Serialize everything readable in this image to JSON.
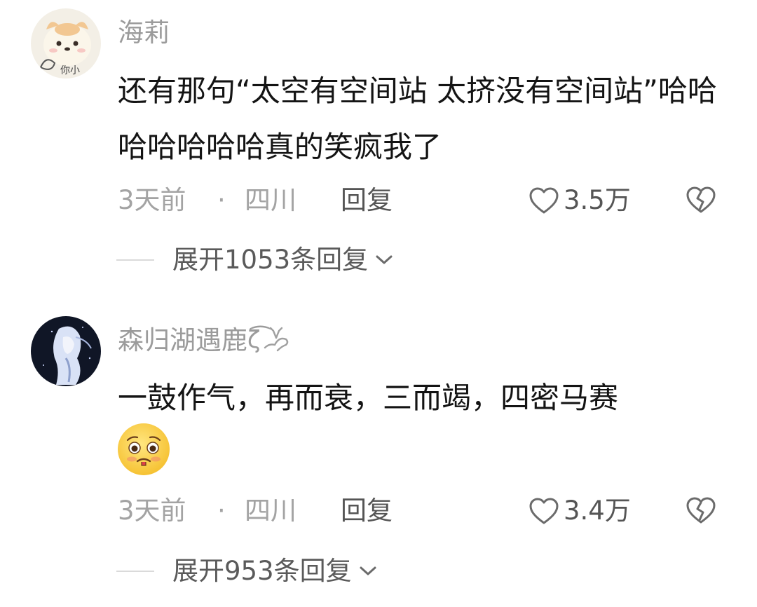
{
  "comments": [
    {
      "username": "海莉",
      "content": "还有那句“太空有空间站 太挤没有空间站”哈哈哈哈哈哈哈真的笑疯我了",
      "time": "3天前",
      "separator": "·",
      "location": "四川",
      "reply_label": "回复",
      "likes": "3.5万",
      "expand_label": "展开1053条回复",
      "avatar_text": "你小"
    },
    {
      "username": "森归湖遇鹿",
      "username_suffix": "ζ͡",
      "content": "一鼓作气，再而衰，三而竭，四密马赛",
      "time": "3天前",
      "separator": "·",
      "location": "四川",
      "reply_label": "回复",
      "likes": "3.4万",
      "expand_label": "展开953条回复",
      "emoji": "pleading-face-emoji"
    }
  ],
  "icons": {
    "like": "heart-outline-icon",
    "dislike": "broken-heart-icon",
    "expand": "chevron-down-icon"
  },
  "colors": {
    "username": "#9b9b9b",
    "content": "#141414",
    "meta": "#a3a3a3",
    "action": "#555555",
    "divider": "#dadada"
  }
}
